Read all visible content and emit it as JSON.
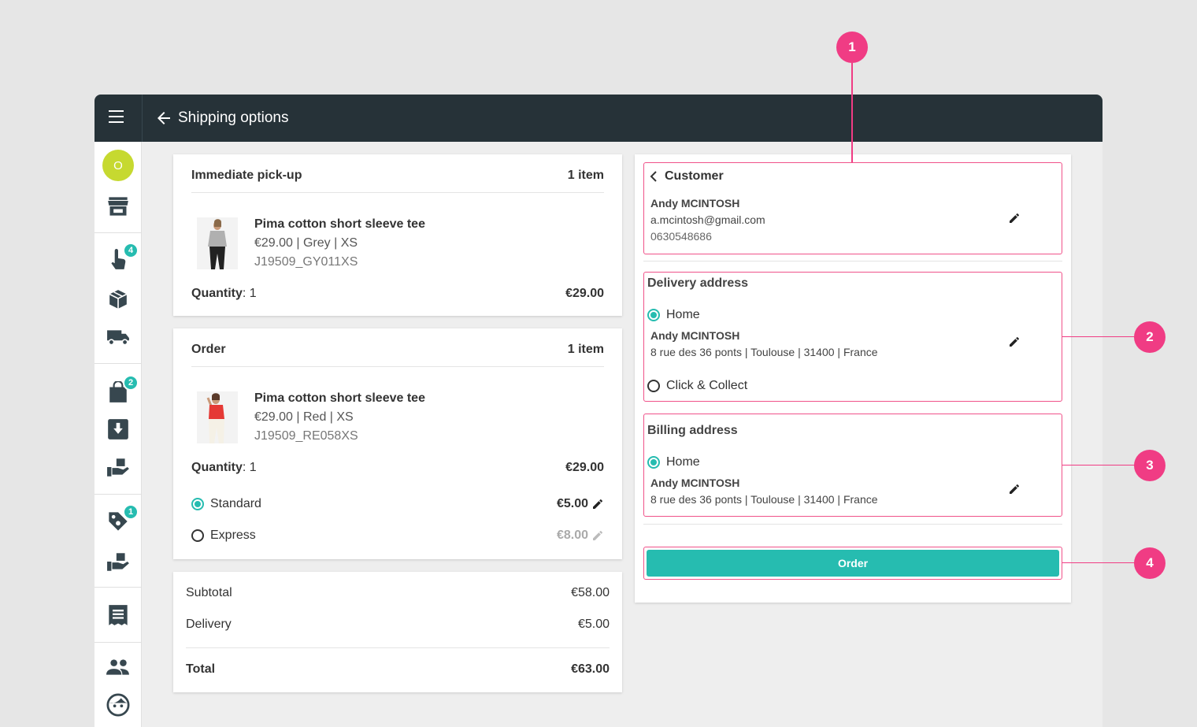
{
  "header": {
    "title": "Shipping options"
  },
  "sidebar": {
    "avatar_letter": "O",
    "badges": {
      "hand": "4",
      "bag": "2",
      "tag": "1"
    }
  },
  "pickup_card": {
    "title": "Immediate pick-up",
    "count": "1 item",
    "product": {
      "name": "Pima cotton short sleeve tee",
      "details": "€29.00 | Grey | XS",
      "sku": "J19509_GY011XS"
    },
    "quantity_label": "Quantity",
    "quantity_value": ": 1",
    "total": "€29.00"
  },
  "order_card": {
    "title": "Order",
    "count": "1 item",
    "product": {
      "name": "Pima cotton short sleeve tee",
      "details": "€29.00 | Red | XS",
      "sku": "J19509_RE058XS"
    },
    "quantity_label": "Quantity",
    "quantity_value": ": 1",
    "total": "€29.00",
    "shipping": [
      {
        "label": "Standard",
        "price": "€5.00",
        "selected": true
      },
      {
        "label": "Express",
        "price": "€8.00",
        "selected": false
      }
    ]
  },
  "summary": {
    "subtotal_label": "Subtotal",
    "subtotal": "€58.00",
    "delivery_label": "Delivery",
    "delivery": "€5.00",
    "total_label": "Total",
    "total": "€63.00"
  },
  "customer": {
    "title": "Customer",
    "name": "Andy MCINTOSH",
    "email": "a.mcintosh@gmail.com",
    "phone": "0630548686"
  },
  "delivery_address": {
    "title": "Delivery address",
    "option_home": "Home",
    "name": "Andy MCINTOSH",
    "address": "8 rue des 36 ponts | Toulouse | 31400 | France",
    "option_collect": "Click & Collect"
  },
  "billing_address": {
    "title": "Billing address",
    "option_home": "Home",
    "name": "Andy MCINTOSH",
    "address": "8 rue des 36 ponts | Toulouse | 31400 | France"
  },
  "order_button": "Order",
  "callouts": [
    "1",
    "2",
    "3",
    "4"
  ],
  "colors": {
    "accent": "#26bcb0",
    "callout": "#f03c84",
    "topbar": "#263238",
    "avatar": "#c6d930"
  }
}
